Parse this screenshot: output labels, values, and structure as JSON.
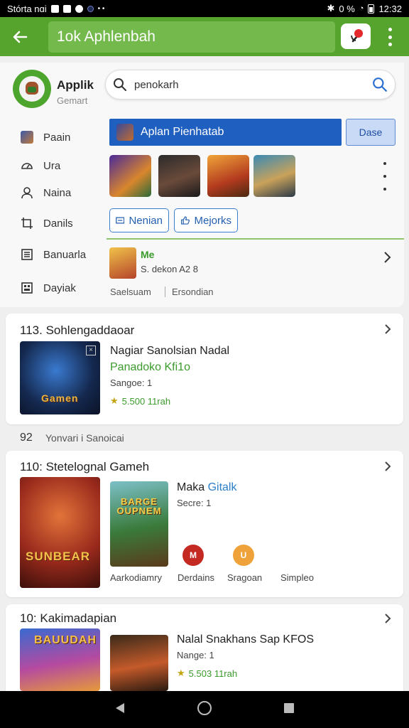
{
  "status_bar": {
    "left_text": "Stórta nɑi",
    "right_text": "0 %",
    "time": "12:32"
  },
  "app_bar": {
    "title": "1ok Aphlenbah"
  },
  "brand": {
    "name": "Applik",
    "subtitle": "Gemart"
  },
  "search": {
    "value": "penokarh"
  },
  "sidebar": {
    "items": [
      {
        "label": "Paain",
        "icon": "game-icon"
      },
      {
        "label": "Ura",
        "icon": "speed-icon"
      },
      {
        "label": "Naina",
        "icon": "user-icon"
      },
      {
        "label": "Danils",
        "icon": "crop-icon"
      },
      {
        "label": "Banuarla",
        "icon": "list-icon"
      },
      {
        "label": "Dayiak",
        "icon": "dashboard-icon"
      }
    ]
  },
  "banner": {
    "label": "Aplan Pienhatab",
    "close_label": "Dase"
  },
  "pills": [
    {
      "label": "Nenian",
      "icon": "screen-icon"
    },
    {
      "label": "Mejorks",
      "icon": "thumbs-up-icon"
    }
  ],
  "featured_row": {
    "title": "Me",
    "subtitle": "S. dekon A2 8",
    "meta_a": "Saelsuam",
    "meta_b": "Ersondian"
  },
  "card1": {
    "number": "113.",
    "title": "Sohlengaddaoar",
    "game_name": "Nagiar Sanolsian Nadal",
    "game_sub": "Panadoko Kfi1o",
    "small": "Sangoe: 1",
    "rating": "5.500 11rah",
    "art_label": "Gamen"
  },
  "section2": {
    "number": "92",
    "label": "Yonvari i Sanoicai"
  },
  "card2": {
    "number": "110:",
    "title": "Stetelognal Gameh",
    "game_name": "Maka",
    "game_name_accent": "Gitalk",
    "small": "Secre: 1",
    "art_label": "SUNBEAR",
    "art2_label": "BARGE OUPNEM",
    "tabs": [
      "Aarkodiamry",
      "Derdains",
      "Sragoan",
      "Simpleo"
    ]
  },
  "card3": {
    "number": "10:",
    "title": "Kakimadapian",
    "game_name": "Nalal Snakhans Sap KFOS",
    "small": "Nange: 1",
    "rating": "5.503 11rah",
    "art_label": "BAUUDAH"
  },
  "colors": {
    "app_bar": "#56a42d",
    "accent_blue": "#1f5fbf",
    "accent_green": "#3b9b2c"
  }
}
